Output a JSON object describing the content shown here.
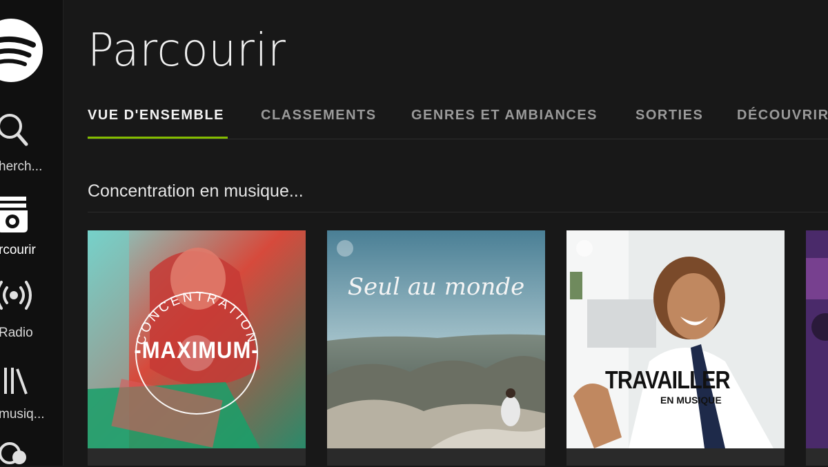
{
  "sidebar": {
    "items": [
      {
        "label": "herch...",
        "icon": "search-icon"
      },
      {
        "label": "rcourir",
        "icon": "browse-icon",
        "active": true
      },
      {
        "label": "Radio",
        "icon": "radio-icon"
      },
      {
        "label": "musiq...",
        "icon": "library-icon"
      },
      {
        "label": "",
        "icon": "follow-icon"
      }
    ]
  },
  "header": {
    "title": "Parcourir"
  },
  "tabs": [
    {
      "label": "VUE D'ENSEMBLE",
      "active": true
    },
    {
      "label": "CLASSEMENTS"
    },
    {
      "label": "GENRES ET AMBIANCES"
    },
    {
      "label": "SORTIES"
    },
    {
      "label": "DÉCOUVRIR"
    }
  ],
  "section": {
    "title": "Concentration en musique..."
  },
  "playlists": [
    {
      "arc_text": "CONCENTRATION",
      "title": "-MAXIMUM-"
    },
    {
      "title": "Seul au monde"
    },
    {
      "title": "TRAVAILLER",
      "subtitle": "EN MUSIQUE"
    },
    {
      "title": ""
    }
  ],
  "colors": {
    "accent": "#84bd00",
    "background": "#181818",
    "sidebar": "#101010"
  }
}
